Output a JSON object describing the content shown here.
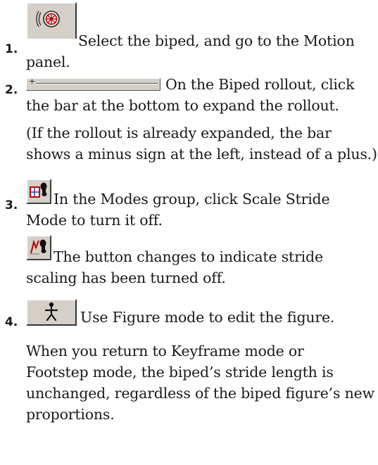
{
  "steps": [
    {
      "number": "1.",
      "icon": "motion-panel-icon",
      "lines": [
        "Select the biped, and go to the Motion",
        "panel."
      ]
    },
    {
      "number": "2.",
      "icon": "rollout-bar-icon",
      "lines": [
        "On the Biped rollout, click",
        "the bar at the bottom to expand the rollout."
      ],
      "bar_symbol": "+",
      "note_lines": [
        "(If the rollout is already expanded, the bar",
        "shows a minus sign at the left, instead of a plus.)"
      ]
    },
    {
      "number": "3.",
      "icon": "scale-stride-mode-icon",
      "lines": [
        "In the Modes group, click Scale Stride",
        "Mode to turn it off."
      ],
      "sub_icon": "scale-stride-off-icon",
      "sub_lines": [
        "The button changes to indicate stride",
        "scaling has been turned off."
      ]
    },
    {
      "number": "4.",
      "icon": "figure-mode-icon",
      "lines": [
        "Use Figure mode to edit the figure."
      ],
      "note_lines": [
        "When you return to Keyframe mode or",
        "Footstep mode, the biped’s stride length is",
        "unchanged, regardless of the biped figure’s new",
        "proportions."
      ]
    }
  ],
  "colors": {
    "text": "#1a1a1a",
    "button_face": "#d4d0c8",
    "icon_red": "#c00000",
    "icon_blue": "#2a3fa8"
  }
}
